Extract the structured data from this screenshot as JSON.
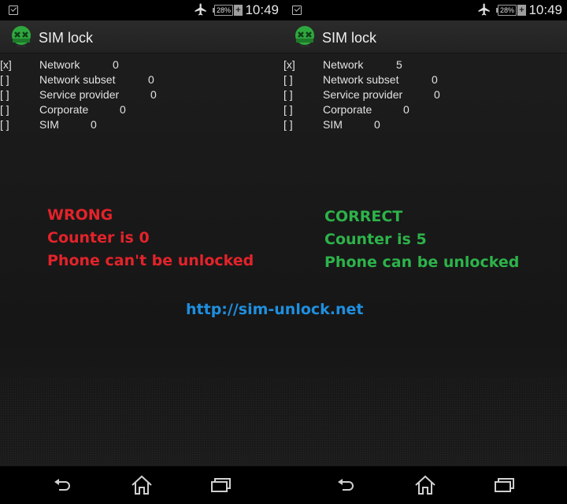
{
  "status_bar": {
    "notification_icon": "checkbox-notification-icon",
    "airplane_icon": "airplane-mode-icon",
    "battery_percent": "28%",
    "charging_symbol": "+",
    "time": "10:49"
  },
  "app": {
    "title": "SIM lock",
    "logo_icon": "sim-unlock-logo-icon"
  },
  "screens": [
    {
      "id": "left",
      "locks": [
        {
          "check": "[x]",
          "name": "Network",
          "count": "0"
        },
        {
          "check": "[ ]",
          "name": "Network subset",
          "count": "0"
        },
        {
          "check": "[ ]",
          "name": "Service provider",
          "count": "0"
        },
        {
          "check": "[ ]",
          "name": "Corporate",
          "count": "0"
        },
        {
          "check": "[ ]",
          "name": "SIM",
          "count": "0"
        }
      ]
    },
    {
      "id": "right",
      "locks": [
        {
          "check": "[x]",
          "name": "Network",
          "count": "5"
        },
        {
          "check": "[ ]",
          "name": "Network subset",
          "count": "0"
        },
        {
          "check": "[ ]",
          "name": "Service provider",
          "count": "0"
        },
        {
          "check": "[ ]",
          "name": "Corporate",
          "count": "0"
        },
        {
          "check": "[ ]",
          "name": "SIM",
          "count": "0"
        }
      ]
    }
  ],
  "annotations": {
    "wrong": {
      "color": "#e3232a",
      "lines": [
        "WRONG",
        "Counter is 0",
        "Phone can't be unlocked"
      ]
    },
    "correct": {
      "color": "#2db34a",
      "lines": [
        "CORRECT",
        "Counter is 5",
        "Phone can be unlocked"
      ]
    },
    "link": {
      "text": "http://sim-unlock.net",
      "color": "#1f8fe0"
    }
  },
  "nav_bar": {
    "back_icon": "back-icon",
    "home_icon": "home-icon",
    "recent_icon": "recent-apps-icon"
  }
}
